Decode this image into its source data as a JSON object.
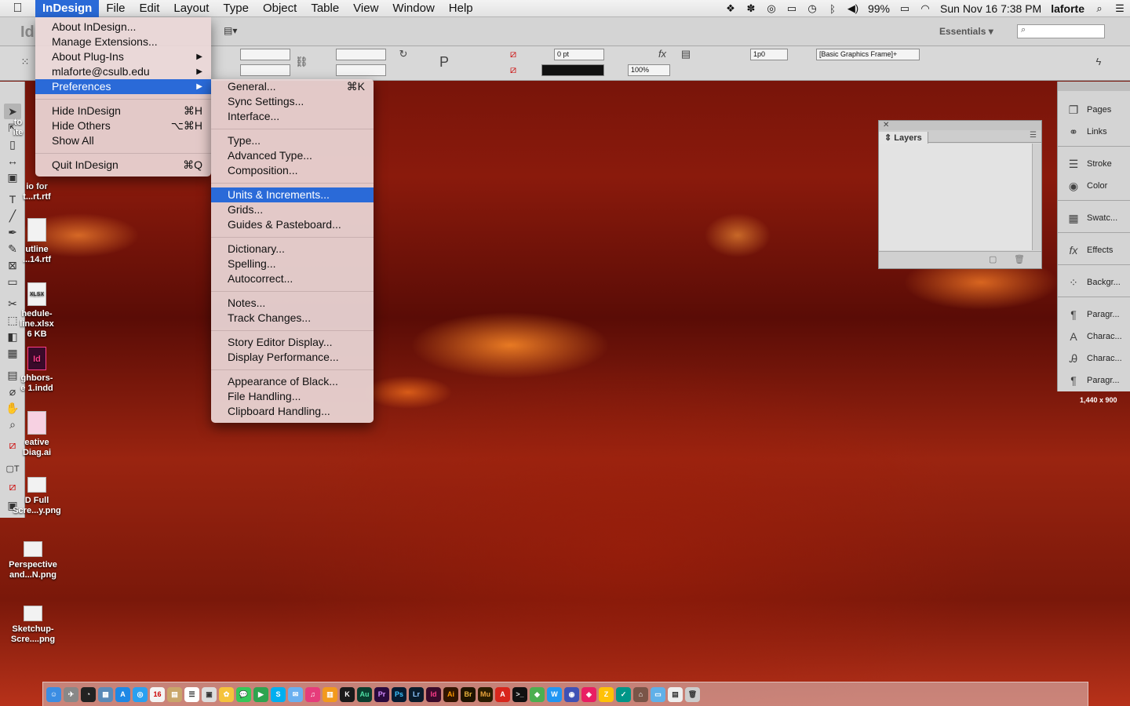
{
  "menubar": {
    "apple": "",
    "items": [
      "InDesign",
      "File",
      "Edit",
      "Layout",
      "Type",
      "Object",
      "Table",
      "View",
      "Window",
      "Help"
    ],
    "battery": "99%",
    "clock": "Sun Nov 16  7:38 PM",
    "user": "laforte"
  },
  "toolbar": {
    "app_logo": "Id",
    "workspace": "Essentials",
    "workspace_arrow": "▾",
    "stroke_weight": "0 pt",
    "scale": "100%",
    "frame_style": "[Basic Graphics Frame]+",
    "gap_value": "1p0"
  },
  "app_menu": {
    "about": "About InDesign...",
    "extensions": "Manage Extensions...",
    "plugins": "About Plug-Ins",
    "account": "mlaforte@csulb.edu",
    "preferences": "Preferences",
    "hide": "Hide InDesign",
    "hide_sc": "⌘H",
    "hide_others": "Hide Others",
    "hide_others_sc": "⌥⌘H",
    "show_all": "Show All",
    "quit": "Quit InDesign",
    "quit_sc": "⌘Q"
  },
  "pref_menu": {
    "general": "General...",
    "general_sc": "⌘K",
    "sync": "Sync Settings...",
    "interface": "Interface...",
    "type": "Type...",
    "advanced_type": "Advanced Type...",
    "composition": "Composition...",
    "units": "Units & Increments...",
    "grids": "Grids...",
    "guides": "Guides & Pasteboard...",
    "dictionary": "Dictionary...",
    "spelling": "Spelling...",
    "autocorrect": "Autocorrect...",
    "notes": "Notes...",
    "track_changes": "Track Changes...",
    "story_editor": "Story Editor Display...",
    "display_perf": "Display Performance...",
    "black": "Appearance of Black...",
    "file_handling": "File Handling...",
    "clipboard": "Clipboard Handling..."
  },
  "layers_panel": {
    "tab": "Layers"
  },
  "dock_panels": {
    "pages": "Pages",
    "links": "Links",
    "stroke": "Stroke",
    "color": "Color",
    "swatches": "Swatc...",
    "effects": "Effects",
    "background": "Backgr...",
    "paragraph": "Paragr...",
    "character": "Charac...",
    "char_styles": "Charac...",
    "para_styles": "Paragr..."
  },
  "screen_size_label": "1,440 x 900",
  "desktop": {
    "icon1": [
      "io for",
      "t...rt.rtf"
    ],
    "icon2": [
      "utline",
      "...14.rtf"
    ],
    "icon3": [
      "hedule-",
      "line.xlsx",
      "6 KB"
    ],
    "icon4": [
      "ghbors-",
      "e 1.indd"
    ],
    "icon5": [
      "eative",
      "Diag.ai"
    ],
    "icon6": [
      "D Full",
      "Scre...y.png"
    ],
    "icon7": [
      "Perspective",
      "and...N.png"
    ],
    "icon8": [
      "Sketchup-",
      "Scre....png"
    ],
    "icon_fragment_a": [
      "to",
      "ite"
    ],
    "thumb_labels": [
      "XLSX",
      "Id"
    ]
  },
  "dock_apps": [
    "Finder",
    "Launchpad",
    "Dashboard",
    "Mission Control",
    "App Store",
    "Safari",
    "Calendar",
    "Notes",
    "Reminders",
    "Preview",
    "Photos",
    "Messages",
    "FaceTime",
    "Skype",
    "Mail",
    "iTunes",
    "iBooks",
    "Kindle",
    "Au",
    "Pr",
    "Ps",
    "Lr",
    "Id",
    "Ai",
    "Br",
    "Mu",
    "Acrobat",
    "Terminal",
    "Trash"
  ],
  "colors": {
    "menu_highlight": "#2a6ad8",
    "menu_bg": "#ebd7d7",
    "panel_bg": "#d4d4d4"
  }
}
